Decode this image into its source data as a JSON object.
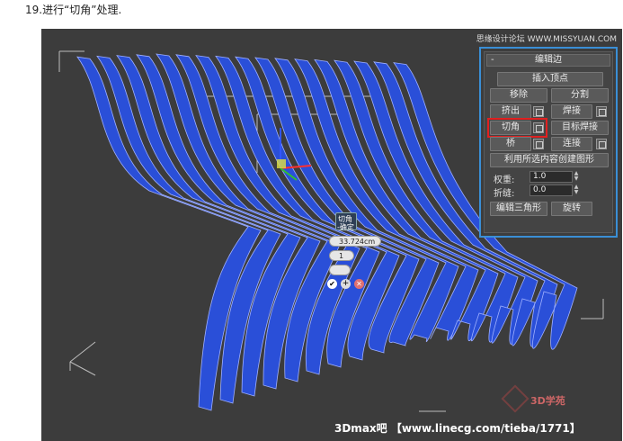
{
  "caption": "19.进行“切角”处理.",
  "panel": {
    "header": "编辑边",
    "minus": "-",
    "insert_vertex": "插入顶点",
    "remove": "移除",
    "split": "分割",
    "extrude": "挤出",
    "weld": "焊接",
    "chamfer": "切角",
    "target_weld": "目标焊接",
    "bridge": "桥",
    "connect": "连接",
    "create_shape": "利用所选内容创建图形",
    "weight_label": "权重:",
    "weight_value": "1.0",
    "crease_label": "折缝:",
    "crease_value": "0.0",
    "edit_tri": "编辑三角形",
    "rotate": "旋转"
  },
  "caddy": {
    "title": "切角",
    "subtitle": "-确定",
    "amount": "33.724cm",
    "segments": "1",
    "ok_icon": "check-icon",
    "apply_icon": "plus-icon",
    "cancel_icon": "close-icon"
  },
  "watermarks": {
    "bottom": "3Dmax吧 【www.linecg.com/tieba/1771】",
    "top_right": "思缘设计论坛 WWW.MISSYUAN.COM",
    "logo": "3D学苑"
  },
  "colors": {
    "accent": "#3a8fd6",
    "highlight": "#e02020",
    "slat": "#2a4fd8"
  }
}
